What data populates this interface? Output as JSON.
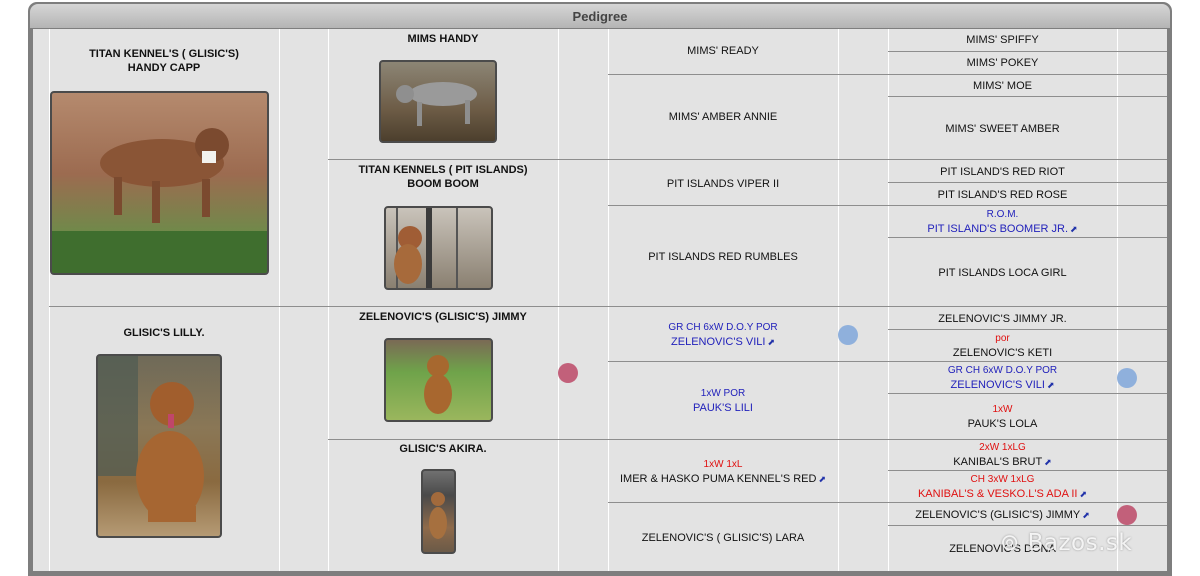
{
  "title": "Pedigree",
  "gen1": [
    {
      "name": "TITAN KENNEL'S ( GLISIC'S)\nHANDY CAPP"
    },
    {
      "name": "GLISIC'S LILLY."
    }
  ],
  "gen2": [
    {
      "name": "MIMS HANDY"
    },
    {
      "name": "TITAN KENNELS ( PIT ISLANDS)\nBOOM BOOM"
    },
    {
      "name": "ZELENOVIC'S (GLISIC'S) JIMMY"
    },
    {
      "name": "GLISIC'S AKIRA."
    }
  ],
  "gen3": [
    {
      "title": "",
      "name": "MIMS' READY"
    },
    {
      "title": "",
      "name": "MIMS' AMBER ANNIE"
    },
    {
      "title": "",
      "name": "PIT ISLANDS VIPER II"
    },
    {
      "title": "",
      "name": "PIT ISLANDS RED RUMBLES"
    },
    {
      "title": "GR CH 6xW D.O.Y POR",
      "name": "ZELENOVIC'S VILI"
    },
    {
      "title": "1xW POR",
      "name": "PAUK'S LILI"
    },
    {
      "title": "1xW 1xL",
      "name": "IMER & HASKO PUMA KENNEL'S RED"
    },
    {
      "title": "",
      "name": "ZELENOVIC'S ( GLISIC'S) LARA"
    }
  ],
  "gen4": [
    {
      "title": "",
      "name": "MIMS' SPIFFY"
    },
    {
      "title": "",
      "name": "MIMS' POKEY"
    },
    {
      "title": "",
      "name": "MIMS' MOE"
    },
    {
      "title": "",
      "name": "MIMS' SWEET AMBER"
    },
    {
      "title": "",
      "name": "PIT ISLAND'S RED RIOT"
    },
    {
      "title": "",
      "name": "PIT ISLAND'S RED ROSE"
    },
    {
      "title": "R.O.M.",
      "name": "PIT ISLAND'S BOOMER JR."
    },
    {
      "title": "",
      "name": "PIT ISLANDS LOCA GIRL"
    },
    {
      "title": "",
      "name": "ZELENOVIC'S JIMMY JR."
    },
    {
      "title": "por",
      "name": "ZELENOVIC'S KETI"
    },
    {
      "title": "GR CH 6xW D.O.Y POR",
      "name": "ZELENOVIC'S VILI"
    },
    {
      "title": "1xW",
      "name": "PAUK'S LOLA"
    },
    {
      "title": "2xW 1xLG",
      "name": "KANIBAL'S BRUT"
    },
    {
      "title": "CH 3xW 1xLG",
      "name": "KANIBAL'S & VESKO.L'S ADA II"
    },
    {
      "title": "",
      "name": "ZELENOVIC'S (GLISIC'S) JIMMY"
    },
    {
      "title": "",
      "name": "ZELENOVIC'S DONA"
    }
  ],
  "watermark": "Bazos.sk",
  "colors": {
    "link": "#2222bb",
    "title_red": "#e01010",
    "marker_blue": "#8fb0dc",
    "marker_pink": "#c2607a"
  },
  "icons": [
    "external-link-icon",
    "dog-photo",
    "marker-dot"
  ]
}
